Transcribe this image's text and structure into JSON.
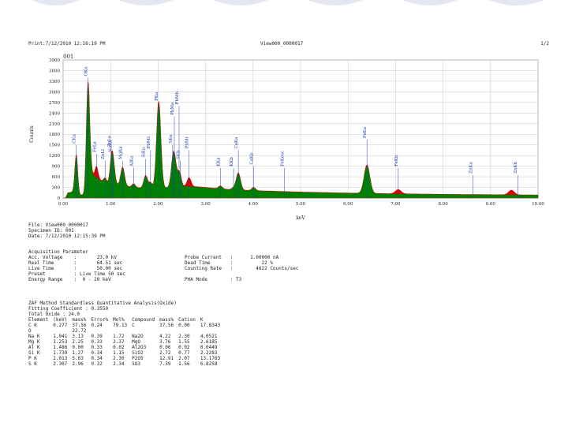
{
  "header": {
    "print_label": "Print:7/12/2010 12:16:19 PM",
    "view_name": "View000_0000017",
    "page": "1/2"
  },
  "chart_data": {
    "type": "line",
    "panel_label": "001",
    "xlabel": "keV",
    "ylabel": "Counts",
    "xlim": [
      0,
      10
    ],
    "ylim": [
      0,
      3900
    ],
    "x_ticks": [
      "0.00",
      "1.00",
      "2.00",
      "3.00",
      "4.00",
      "5.00",
      "6.00",
      "7.00",
      "8.00",
      "9.00",
      "10.00"
    ],
    "y_ticks": [
      "3900",
      "3600",
      "3300",
      "3000",
      "2700",
      "2400",
      "2100",
      "1800",
      "1500",
      "1200",
      "900",
      "600",
      "300",
      "0"
    ],
    "colors": {
      "assigned_fill": "#008000",
      "residual": "#dd0000",
      "label": "#1f3fb0"
    },
    "baseline": [
      [
        0.05,
        0
      ],
      [
        0.1,
        150
      ],
      [
        0.2,
        170
      ],
      [
        0.35,
        90
      ],
      [
        0.45,
        80
      ],
      [
        0.6,
        700
      ],
      [
        0.8,
        500
      ],
      [
        1.0,
        380
      ],
      [
        1.2,
        360
      ],
      [
        1.5,
        300
      ],
      [
        1.8,
        270
      ],
      [
        2.0,
        280
      ],
      [
        2.3,
        300
      ],
      [
        2.6,
        340
      ],
      [
        3.0,
        300
      ],
      [
        3.5,
        240
      ],
      [
        4.0,
        210
      ],
      [
        5.0,
        170
      ],
      [
        6.0,
        140
      ],
      [
        7.0,
        120
      ],
      [
        8.0,
        105
      ],
      [
        9.0,
        95
      ],
      [
        10.0,
        85
      ]
    ],
    "peaks": [
      {
        "label": "CKa",
        "x": 0.277,
        "y": 1100,
        "w": 0.03,
        "c": "g"
      },
      {
        "label": "OKa",
        "x": 0.525,
        "y": 2900,
        "w": 0.035,
        "c": "g"
      },
      {
        "label": "FeLa",
        "x": 0.705,
        "y": 300,
        "w": 0.03,
        "c": "r"
      },
      {
        "label": "ZnLl",
        "x": 0.884,
        "y": 120,
        "w": 0.03,
        "c": "g"
      },
      {
        "label": "NaKa",
        "x": 1.041,
        "y": 820,
        "w": 0.04,
        "c": "g"
      },
      {
        "label": "ZnLa",
        "x": 1.012,
        "y": 200,
        "w": 0.03,
        "c": "g"
      },
      {
        "label": "MgKa",
        "x": 1.253,
        "y": 520,
        "w": 0.04,
        "c": "g"
      },
      {
        "label": "AlKa",
        "x": 1.486,
        "y": 100,
        "w": 0.035,
        "c": "g"
      },
      {
        "label": "SiKa",
        "x": 1.739,
        "y": 360,
        "w": 0.04,
        "c": "g"
      },
      {
        "label": "PbMz",
        "x": 1.841,
        "y": 160,
        "w": 0.035,
        "c": "g"
      },
      {
        "label": "PKa",
        "x": 2.013,
        "y": 2450,
        "w": 0.045,
        "c": "g"
      },
      {
        "label": "PbMa",
        "x": 2.342,
        "y": 720,
        "w": 0.045,
        "c": "g"
      },
      {
        "label": "SKa",
        "x": 2.307,
        "y": 380,
        "w": 0.04,
        "c": "g"
      },
      {
        "label": "PbMb",
        "x": 2.442,
        "y": 300,
        "w": 0.04,
        "c": "g"
      },
      {
        "label": "SKb",
        "x": 2.464,
        "y": 120,
        "w": 0.03,
        "c": "g"
      },
      {
        "label": "PbMr",
        "x": 2.653,
        "y": 240,
        "w": 0.04,
        "c": "r"
      },
      {
        "label": "KKa",
        "x": 3.312,
        "y": 80,
        "w": 0.04,
        "c": "g"
      },
      {
        "label": "KKb",
        "x": 3.589,
        "y": 50,
        "w": 0.04,
        "c": "g"
      },
      {
        "label": "CaKa",
        "x": 3.69,
        "y": 480,
        "w": 0.045,
        "c": "g"
      },
      {
        "label": "CaKb",
        "x": 4.012,
        "y": 90,
        "w": 0.04,
        "c": "g"
      },
      {
        "label": "FeKesc",
        "x": 4.66,
        "y": 0,
        "w": 0.04,
        "c": "g"
      },
      {
        "label": "FeKa",
        "x": 6.398,
        "y": 800,
        "w": 0.06,
        "c": "g"
      },
      {
        "label": "FeKb",
        "x": 7.057,
        "y": 120,
        "w": 0.06,
        "c": "r"
      },
      {
        "label": "ZnKa",
        "x": 8.63,
        "y": 0,
        "w": 0.06,
        "c": "g"
      },
      {
        "label": "ZnKb",
        "x": 9.572,
        "y": 0,
        "w": 0.06,
        "c": "r"
      },
      {
        "label": "",
        "x": 9.44,
        "y": 130,
        "w": 0.06,
        "c": "r"
      }
    ],
    "label_markers": [
      {
        "label": "CKa",
        "x": 0.277,
        "y": 1500
      },
      {
        "label": "OKa",
        "x": 0.525,
        "y": 3400
      },
      {
        "label": "FeLa",
        "x": 0.705,
        "y": 1250
      },
      {
        "label": "ZnLl",
        "x": 0.884,
        "y": 1050
      },
      {
        "label": "NaKa",
        "x": 1.041,
        "y": 1250
      },
      {
        "label": "ZnLa",
        "x": 1.012,
        "y": 1400
      },
      {
        "label": "MgKa",
        "x": 1.253,
        "y": 1050
      },
      {
        "label": "AlKa",
        "x": 1.486,
        "y": 850
      },
      {
        "label": "SiKa",
        "x": 1.739,
        "y": 1100
      },
      {
        "label": "PbMz",
        "x": 1.841,
        "y": 1350
      },
      {
        "label": "PKa",
        "x": 2.013,
        "y": 2700
      },
      {
        "label": "PbMa",
        "x": 2.342,
        "y": 2300
      },
      {
        "label": "SKa",
        "x": 2.307,
        "y": 1500
      },
      {
        "label": "PbMb",
        "x": 2.442,
        "y": 2600
      },
      {
        "label": "SKb",
        "x": 2.464,
        "y": 1050
      },
      {
        "label": "PbMr",
        "x": 2.653,
        "y": 1350
      },
      {
        "label": "KKa",
        "x": 3.312,
        "y": 850
      },
      {
        "label": "KKb",
        "x": 3.589,
        "y": 850
      },
      {
        "label": "CaKa",
        "x": 3.69,
        "y": 1350
      },
      {
        "label": "CaKb",
        "x": 4.012,
        "y": 900
      },
      {
        "label": "FeKesc",
        "x": 4.66,
        "y": 850
      },
      {
        "label": "FeKa",
        "x": 6.398,
        "y": 1650
      },
      {
        "label": "FeKb",
        "x": 7.057,
        "y": 850
      },
      {
        "label": "ZnKa",
        "x": 8.63,
        "y": 650
      },
      {
        "label": "ZnKb",
        "x": 9.572,
        "y": 650
      }
    ]
  },
  "file_info": {
    "file": "File: View000_0000017",
    "specimen": "Specimen ID: 001",
    "date": "Date: 7/12/2010 12:15:39 PM"
  },
  "acquisition": {
    "heading": "Acquisition Parameter",
    "col1": "Acc. Voltage    :       23.0 kV\nReal Time       :       64.51 sec\nLive Time       :       50.00 sec\nPreset          : Live Time 50 sec\nEnergy Range    :  0 - 20 keV",
    "col2": "Probe Current   :      1.00000 nA\nDead Time       :          22 %\nCounting Rate   :        4622 Counts/sec\n\nPHA Mode        : T3"
  },
  "zaf": {
    "heading": "ZAF Method Standardless Quantitative Analysis(Oxide)",
    "fitting": "Fitting Coefficient : 0.3550",
    "total": "Total Oxide : 24.0",
    "columns": [
      "Element",
      "(keV)",
      "mass%",
      "Error%",
      "Mol%",
      "Compound",
      "mass%",
      "Cation",
      "K"
    ],
    "rows": [
      [
        " C K",
        "0.277",
        "37.56",
        "0.24",
        "79.13",
        "C",
        "37.56",
        "0.00",
        "17.8343"
      ],
      [
        " O",
        "",
        "22.72",
        "",
        "",
        "",
        "",
        "",
        ""
      ],
      [
        "Na K",
        "1.041",
        "3.13",
        "0.39",
        "1.72",
        "Na2O",
        "4.22",
        "2.30",
        "4.0521"
      ],
      [
        "Mg K",
        "1.253",
        "2.25",
        "0.33",
        "2.37",
        "MgO",
        "3.76",
        "1.55",
        "2.6185"
      ],
      [
        "Al K",
        "1.486",
        "0.00",
        "0.33",
        "0.02",
        "Al2O3",
        "0.06",
        "0.02",
        "0.0449"
      ],
      [
        "Si K",
        "1.739",
        "1.27",
        "0.34",
        "1.15",
        "SiO2",
        "2.72",
        "0.77",
        "2.2283"
      ],
      [
        " P K",
        "2.013",
        "5.63",
        "0.34",
        "2.30",
        "P2O5",
        "12.91",
        "2.07",
        "13.1763"
      ],
      [
        " S K",
        "2.307",
        "2.96",
        "0.32",
        "2.34",
        "SO3",
        "7.39",
        "1.56",
        "6.8258"
      ]
    ]
  }
}
